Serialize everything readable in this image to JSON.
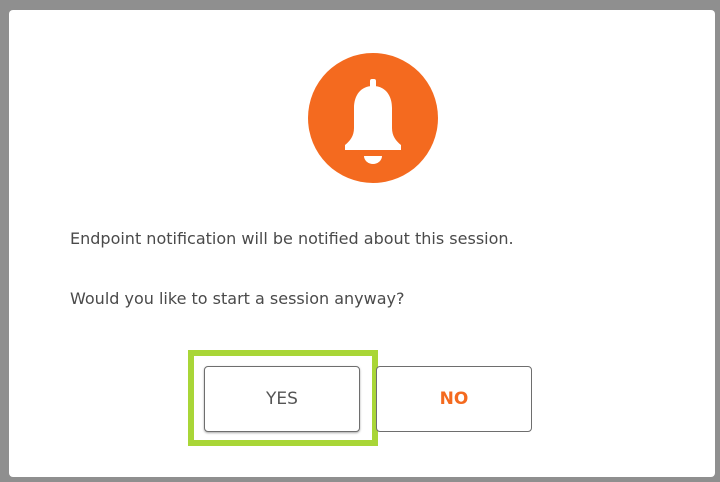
{
  "colors": {
    "accent": "#f46a1f",
    "highlight": "#a9d637"
  },
  "dialog": {
    "icon": "bell-icon",
    "message_line1": "Endpoint notification will be notified about this session.",
    "message_line2": "Would you like to start a session anyway?",
    "yes_label": "YES",
    "no_label": "NO"
  }
}
